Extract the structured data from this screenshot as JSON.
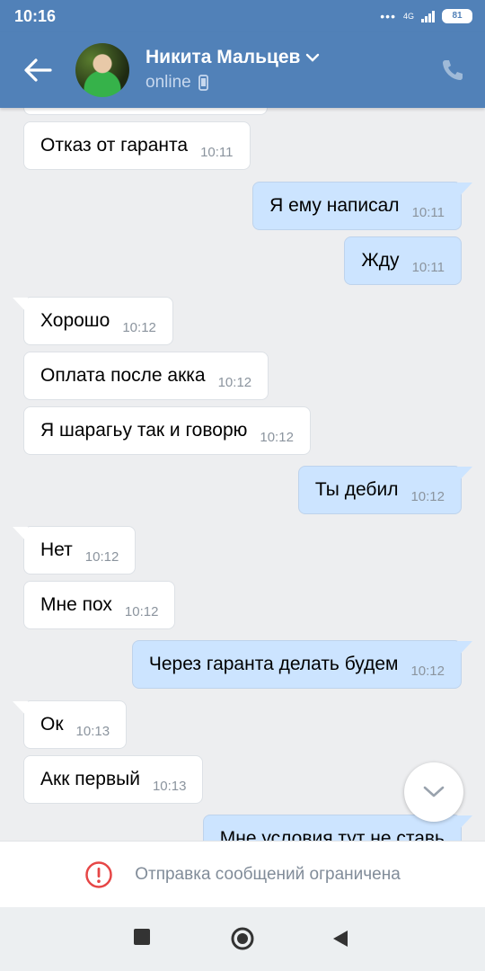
{
  "status_bar": {
    "time": "10:16",
    "network": "4G",
    "battery": "81"
  },
  "header": {
    "contact_name": "Никита Мальцев",
    "presence": "online"
  },
  "messages": [
    {
      "dir": "in",
      "text": "Отказ от гаранта",
      "time": "10:11"
    },
    {
      "dir": "out",
      "text": "Я ему написал",
      "time": "10:11"
    },
    {
      "dir": "out",
      "text": "Жду",
      "time": "10:11"
    },
    {
      "dir": "in",
      "text": "Хорошо",
      "time": "10:12"
    },
    {
      "dir": "in",
      "text": "Оплата после акка",
      "time": "10:12"
    },
    {
      "dir": "in",
      "text": "Я шарагьу так и говорю",
      "time": "10:12"
    },
    {
      "dir": "out",
      "text": "Ты дебил",
      "time": "10:12"
    },
    {
      "dir": "in",
      "text": "Нет",
      "time": "10:12"
    },
    {
      "dir": "in",
      "text": "Мне пох",
      "time": "10:12"
    },
    {
      "dir": "out",
      "text": "Через гаранта делать будем",
      "time": "10:12"
    },
    {
      "dir": "in",
      "text": "Ок",
      "time": "10:13"
    },
    {
      "dir": "in",
      "text": "Акк первый",
      "time": "10:13"
    },
    {
      "dir": "out",
      "text": "Мне условия тут не ставь",
      "time": ""
    }
  ],
  "restriction_notice": "Отправка сообщений ограничена",
  "colors": {
    "header": "#5181b8",
    "outgoing_bubble": "#cce4ff",
    "incoming_bubble": "#ffffff",
    "background": "#edeef0"
  }
}
